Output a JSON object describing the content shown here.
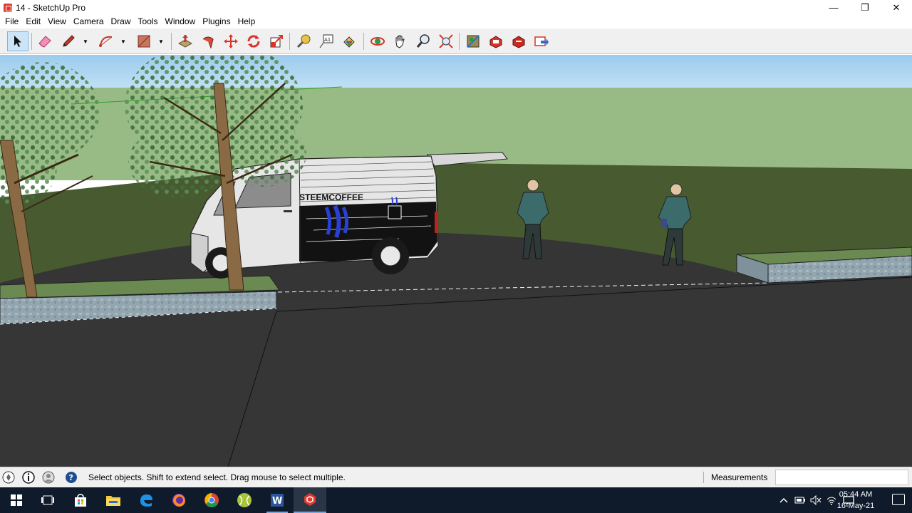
{
  "window": {
    "title": "14 - SketchUp Pro",
    "controls": {
      "minimize": "—",
      "maximize": "❐",
      "close": "✕"
    }
  },
  "menu": [
    "File",
    "Edit",
    "View",
    "Camera",
    "Draw",
    "Tools",
    "Window",
    "Plugins",
    "Help"
  ],
  "toolbar": {
    "tools": [
      {
        "name": "select-tool",
        "icon": "select-arrow-icon",
        "selected": true
      },
      {
        "name": "eraser-tool",
        "icon": "eraser-icon"
      },
      {
        "name": "line-tool",
        "icon": "pencil-icon"
      },
      {
        "name": "arc-tool",
        "icon": "arc-icon"
      },
      {
        "name": "rectangle-tool",
        "icon": "rectangle-icon"
      },
      {
        "name": "push-pull-tool",
        "icon": "push-pull-icon"
      },
      {
        "name": "follow-me-tool",
        "icon": "follow-me-icon"
      },
      {
        "name": "move-tool",
        "icon": "move-icon"
      },
      {
        "name": "rotate-tool",
        "icon": "rotate-icon"
      },
      {
        "name": "scale-tool",
        "icon": "scale-icon"
      },
      {
        "name": "tape-measure-tool",
        "icon": "tape-measure-icon"
      },
      {
        "name": "text-tool",
        "icon": "text-icon"
      },
      {
        "name": "paint-bucket-tool",
        "icon": "paint-bucket-icon"
      },
      {
        "name": "orbit-tool",
        "icon": "orbit-icon"
      },
      {
        "name": "pan-tool",
        "icon": "pan-hand-icon"
      },
      {
        "name": "zoom-tool",
        "icon": "zoom-icon"
      },
      {
        "name": "zoom-extents-tool",
        "icon": "zoom-extents-icon"
      },
      {
        "name": "warehouse-tool",
        "icon": "3d-warehouse-icon"
      },
      {
        "name": "extension-warehouse-tool",
        "icon": "extension-warehouse-icon"
      },
      {
        "name": "extension-manager-tool",
        "icon": "extension-manager-icon"
      },
      {
        "name": "send-to-layout-tool",
        "icon": "send-to-layout-icon"
      }
    ]
  },
  "scene": {
    "van_text": "STEEMCOFFEE",
    "sky_color": "#8fc3e9",
    "grass_color": "#98bb86",
    "ground_color": "#485a30",
    "road_color": "#353535"
  },
  "status": {
    "message": "Select objects. Shift to extend select. Drag mouse to select multiple.",
    "measurements_label": "Measurements",
    "measurements_value": ""
  },
  "taskbar": {
    "apps": [
      "start-icon",
      "task-view-icon",
      "store-icon",
      "file-explorer-icon",
      "edge-icon",
      "firefox-icon",
      "chrome-icon",
      "tennis-ball-app-icon",
      "word-icon",
      "sketchup-icon"
    ],
    "time": "05:44 AM",
    "date": "16-May-21"
  }
}
